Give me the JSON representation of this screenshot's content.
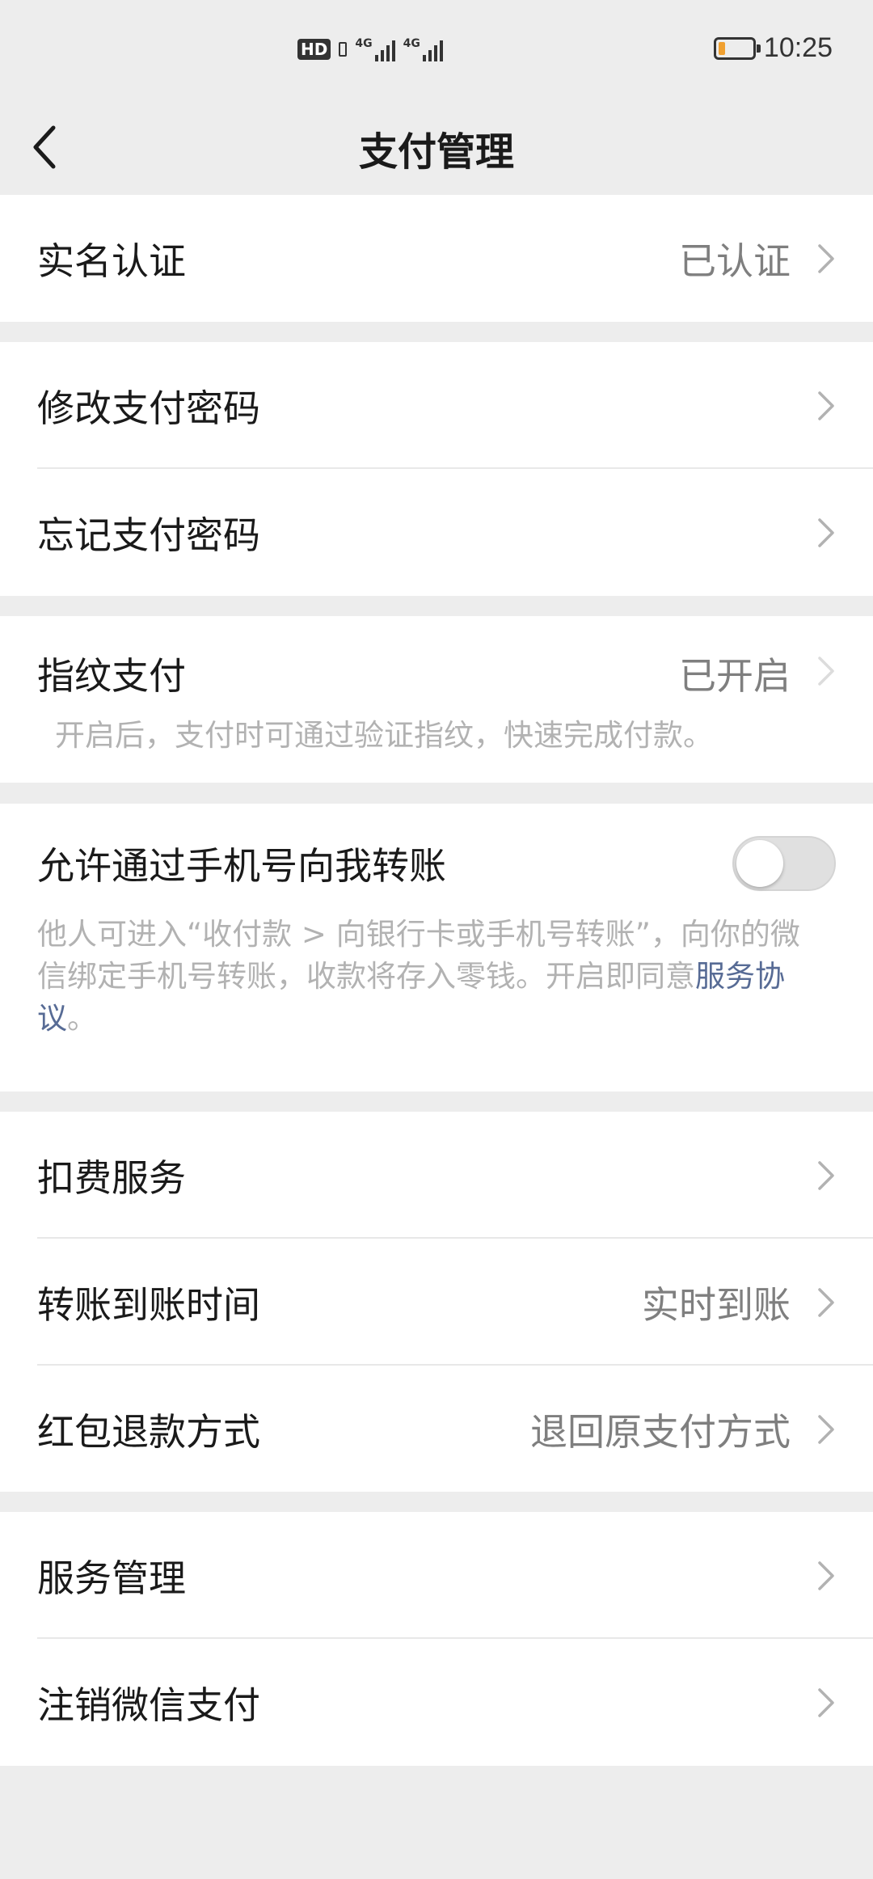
{
  "status_bar": {
    "hd": "HD",
    "sig1_label": "4G",
    "sig2_label": "4G",
    "time": "10:25",
    "battery_level": 0.2,
    "battery_color": "#f0a030"
  },
  "nav": {
    "title": "支付管理",
    "back_icon": "chevron-left-icon"
  },
  "realname": {
    "label": "实名认证",
    "value": "已认证"
  },
  "password": {
    "change_label": "修改支付密码",
    "forget_label": "忘记支付密码"
  },
  "fingerprint": {
    "label": "指纹支付",
    "value": "已开启",
    "desc": "开启后，支付时可通过验证指纹，快速完成付款。"
  },
  "phone_transfer": {
    "label": "允许通过手机号向我转账",
    "toggle_on": false,
    "desc_line1": "他人可进入“收付款 > 向银行卡或手机号转账”，向你的微",
    "desc_line2_text": "信绑定手机号转账，收款将存入零钱。开启即同意",
    "desc_line2_link": "服务协",
    "desc_line3_link": "议",
    "desc_line3_end": "。"
  },
  "services": {
    "deduct_label": "扣费服务",
    "arrival_label": "转账到账时间",
    "arrival_value": "实时到账",
    "refund_label": "红包退款方式",
    "refund_value": "退回原支付方式"
  },
  "manage": {
    "service_label": "服务管理",
    "cancel_label": "注销微信支付"
  },
  "colors": {
    "background": "#ededed",
    "link": "#576b95",
    "secondary_text": "#7f7f7f",
    "hint_text": "#b2b2b2"
  }
}
